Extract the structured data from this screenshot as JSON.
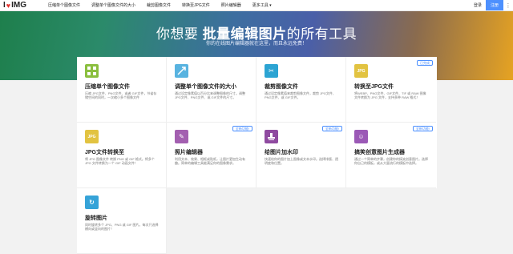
{
  "header": {
    "logo_text": "IMG",
    "nav": [
      "压缩单个图像文件",
      "调整单个图像文件的大小",
      "裁剪图像文件",
      "转换至JPG文件",
      "照片编辑器",
      "更多工具 ▾"
    ],
    "login": "登录",
    "signup": "注册"
  },
  "hero": {
    "title_prefix": "你想要",
    "title_bold": "批量编辑图片",
    "title_suffix": "的所有工具",
    "subtitle": "你的在线图片编辑器就在这里，而且永远免费！"
  },
  "tools": [
    {
      "title": "压缩单个图像文件",
      "desc": "压缩 JPG文件、PNG文件、或者 GIF文件，节省存储空间的同时，一次缩小多个图像文件",
      "color": "#8bbf3f",
      "icon": "compress-icon",
      "badge": ""
    },
    {
      "title": "调整单个图像文件的大小",
      "desc": "通过设定像素值以百分比来调整图像的尺寸。调整 JPG文件、PNG文件、或 GIF文件的尺寸。",
      "color": "#58b3e0",
      "icon": "resize-icon",
      "badge": ""
    },
    {
      "title": "裁剪图像文件",
      "desc": "通过设定像素值来裁剪图像文件，裁剪 JPG文件、PNG文件、或 GIF文件。",
      "color": "#2ca4d3",
      "icon": "crop-icon",
      "badge": ""
    },
    {
      "title": "转换至JPG文件",
      "desc": "将WEBP、PNG文件、GIF文件、TIF 或 RAW 图像文件转换为 JPG 文件，支持多种 RAW 格式！",
      "color": "#e2c341",
      "icon": "convert-icon",
      "badge": "已完成"
    },
    {
      "title": "JPG文件转换至",
      "desc": "将 JPG 图像文件 转换 PNG 或 GIF 格式。将多个 JPG 文件转换为一个 GIF 动画文件！",
      "color": "#e2c341",
      "icon": "jpg-icon",
      "badge": ""
    },
    {
      "title": "照片编辑器",
      "desc": "利用文本、效果、相框或贴纸，让图片更加生动有趣。简单的编辑工具能满足你的图像需求。",
      "color": "#a35fb0",
      "icon": "edit-icon",
      "badge": "全新功能!"
    },
    {
      "title": "给图片加水印",
      "desc": "快速给你的图片加上图像或文本水印。选择排版、透明度和位置。",
      "color": "#8f4aa0",
      "icon": "watermark-icon",
      "badge": "全新功能!"
    },
    {
      "title": "搞笑创意图片生成器",
      "desc": "通过一个简单的步骤，创建你的搞笑创意图片。选择你自己的模板，或从大量流行的模板中选择。",
      "color": "#9b59b6",
      "icon": "meme-icon",
      "badge": "全新功能!"
    },
    {
      "title": "旋转图片",
      "desc": "同时旋转多个 JPG、PNG 或 GIF 图片。每次只选择横向或竖向的图片！",
      "color": "#36a3d8",
      "icon": "rotate-icon",
      "badge": ""
    }
  ]
}
